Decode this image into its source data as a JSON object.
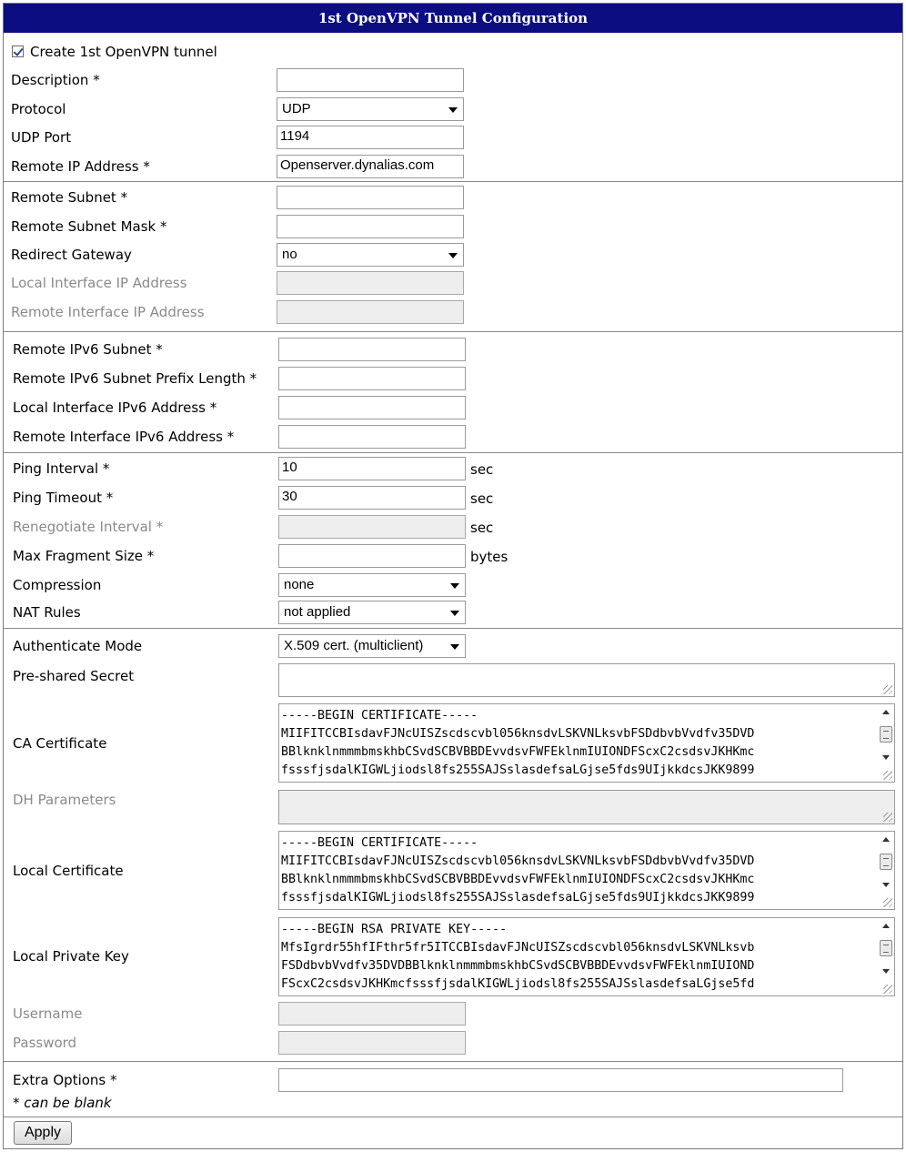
{
  "title": "1st OpenVPN Tunnel Configuration",
  "create_tunnel": {
    "label": "Create 1st OpenVPN tunnel",
    "checked": true
  },
  "fields": {
    "description": {
      "label": "Description *",
      "value": ""
    },
    "protocol": {
      "label": "Protocol",
      "value": "UDP"
    },
    "udp_port": {
      "label": "UDP Port",
      "value": "1194"
    },
    "remote_ip": {
      "label": "Remote IP Address *",
      "value": "Openserver.dynalias.com"
    },
    "remote_subnet": {
      "label": "Remote Subnet *",
      "value": ""
    },
    "remote_subnet_mask": {
      "label": "Remote Subnet Mask *",
      "value": ""
    },
    "redirect_gateway": {
      "label": "Redirect Gateway",
      "value": "no"
    },
    "local_if_ip": {
      "label": "Local Interface IP Address",
      "value": ""
    },
    "remote_if_ip": {
      "label": "Remote Interface IP Address",
      "value": ""
    },
    "remote_ipv6_subnet": {
      "label": "Remote IPv6 Subnet *",
      "value": ""
    },
    "remote_ipv6_prefix": {
      "label": "Remote IPv6 Subnet Prefix Length *",
      "value": ""
    },
    "local_if_ipv6": {
      "label": "Local Interface IPv6 Address *",
      "value": ""
    },
    "remote_if_ipv6": {
      "label": "Remote Interface IPv6 Address *",
      "value": ""
    },
    "ping_interval": {
      "label": "Ping Interval *",
      "value": "10",
      "unit": "sec"
    },
    "ping_timeout": {
      "label": "Ping Timeout *",
      "value": "30",
      "unit": "sec"
    },
    "renegotiate_interval": {
      "label": "Renegotiate Interval *",
      "value": "",
      "unit": "sec"
    },
    "max_fragment": {
      "label": "Max Fragment Size *",
      "value": "",
      "unit": "bytes"
    },
    "compression": {
      "label": "Compression",
      "value": "none"
    },
    "nat_rules": {
      "label": "NAT Rules",
      "value": "not applied"
    },
    "auth_mode": {
      "label": "Authenticate Mode",
      "value": "X.509 cert. (multiclient)"
    },
    "psk": {
      "label": "Pre-shared Secret"
    },
    "ca_cert": {
      "label": "CA Certificate",
      "lines": [
        "-----BEGIN CERTIFICATE-----",
        "MIIFITCCBIsdavFJNcUISZscdscvbl056knsdvLSKVNLksvbFSDdbvbVvdfv35DVD",
        "BBlknklnmmmbmskhbCSvdSCBVBBDEvvdsvFWFEklnmIUIONDFScxC2csdsvJKHKmc",
        "fsssfjsdalKIGWLjiodsl8fs255SAJSslasdefsaLGjse5fds9UIjkkdcsJKK9899"
      ]
    },
    "dh_params": {
      "label": "DH Parameters"
    },
    "local_cert": {
      "label": "Local Certificate",
      "lines": [
        "-----BEGIN CERTIFICATE-----",
        "MIIFITCCBIsdavFJNcUISZscdscvbl056knsdvLSKVNLksvbFSDdbvbVvdfv35DVD",
        "BBlknklnmmmbmskhbCSvdSCBVBBDEvvdsvFWFEklnmIUIONDFScxC2csdsvJKHKmc",
        "fsssfjsdalKIGWLjiodsl8fs255SAJSslasdefsaLGjse5fds9UIjkkdcsJKK9899"
      ]
    },
    "local_key": {
      "label": "Local Private Key",
      "lines": [
        "-----BEGIN RSA PRIVATE KEY-----",
        "MfsIgrdr55hfIFthr5fr5ITCCBIsdavFJNcUISZscdscvbl056knsdvLSKVNLksvb",
        "FSDdbvbVvdfv35DVDBBlknklnmmmbmskhbCSvdSCBVBBDEvvdsvFWFEklnmIUIOND",
        "FScxC2csdsvJKHKmcfsssfjsdalKIGWLjiodsl8fs255SAJSslasdefsaLGjse5fd"
      ]
    },
    "username": {
      "label": "Username",
      "value": ""
    },
    "password": {
      "label": "Password",
      "value": ""
    },
    "extra_options": {
      "label": "Extra Options *",
      "value": ""
    }
  },
  "footnote": "* can be blank",
  "apply_label": "Apply"
}
